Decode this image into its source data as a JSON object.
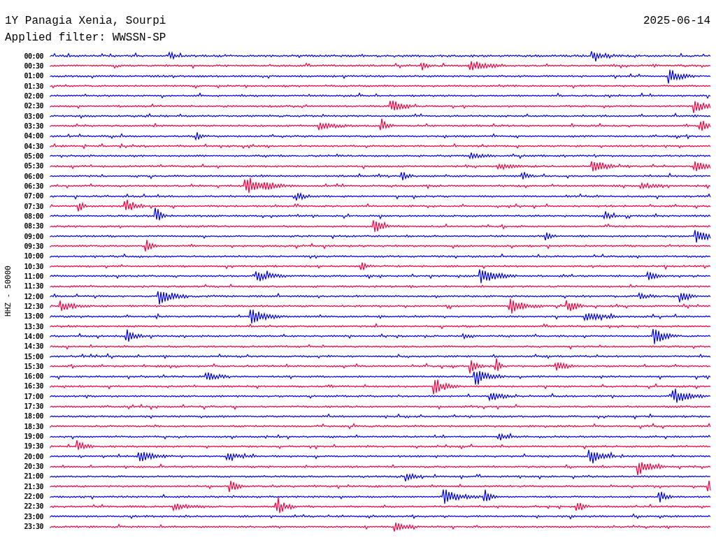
{
  "header": {
    "station": "1Y Panagia Xenia, Sourpi",
    "date": "2025-06-14",
    "filter": "Applied filter: WWSSN-SP"
  },
  "axis_label": "HHZ - 50000",
  "rows": [
    {
      "label": "00:00",
      "color": "#0000ff"
    },
    {
      "label": "00:30",
      "color": "#ff0040"
    },
    {
      "label": "01:00",
      "color": "#0000ff"
    },
    {
      "label": "01:30",
      "color": "#ff0040"
    },
    {
      "label": "02:00",
      "color": "#0000ff"
    },
    {
      "label": "02:30",
      "color": "#ff0040"
    },
    {
      "label": "03:00",
      "color": "#0000ff"
    },
    {
      "label": "03:30",
      "color": "#ff0040"
    },
    {
      "label": "04:00",
      "color": "#0000ff"
    },
    {
      "label": "04:30",
      "color": "#ff0040"
    },
    {
      "label": "05:00",
      "color": "#0000ff"
    },
    {
      "label": "05:30",
      "color": "#ff0040"
    },
    {
      "label": "06:00",
      "color": "#0000ff"
    },
    {
      "label": "06:30",
      "color": "#ff0040"
    },
    {
      "label": "07:00",
      "color": "#0000ff"
    },
    {
      "label": "07:30",
      "color": "#ff0040"
    },
    {
      "label": "08:00",
      "color": "#0000ff"
    },
    {
      "label": "08:30",
      "color": "#ff0040"
    },
    {
      "label": "09:00",
      "color": "#0000ff"
    },
    {
      "label": "09:30",
      "color": "#ff0040"
    },
    {
      "label": "10:00",
      "color": "#0000ff"
    },
    {
      "label": "10:30",
      "color": "#ff0040"
    },
    {
      "label": "11:00",
      "color": "#0000ff"
    },
    {
      "label": "11:30",
      "color": "#ff0040"
    },
    {
      "label": "12:00",
      "color": "#0000ff"
    },
    {
      "label": "12:30",
      "color": "#ff0040"
    },
    {
      "label": "13:00",
      "color": "#0000ff"
    },
    {
      "label": "13:30",
      "color": "#ff0040"
    },
    {
      "label": "14:00",
      "color": "#0000ff"
    },
    {
      "label": "14:30",
      "color": "#ff0040"
    },
    {
      "label": "15:00",
      "color": "#0000ff"
    },
    {
      "label": "15:30",
      "color": "#ff0040"
    },
    {
      "label": "16:00",
      "color": "#0000ff"
    },
    {
      "label": "16:30",
      "color": "#ff0040"
    },
    {
      "label": "17:00",
      "color": "#0000ff"
    },
    {
      "label": "17:30",
      "color": "#ff0040"
    },
    {
      "label": "18:00",
      "color": "#0000ff"
    },
    {
      "label": "18:30",
      "color": "#ff0040"
    },
    {
      "label": "19:00",
      "color": "#0000ff"
    },
    {
      "label": "19:30",
      "color": "#ff0040"
    },
    {
      "label": "20:00",
      "color": "#0000ff"
    },
    {
      "label": "20:30",
      "color": "#ff0040"
    },
    {
      "label": "21:00",
      "color": "#0000ff"
    },
    {
      "label": "21:30",
      "color": "#ff0040"
    },
    {
      "label": "22:00",
      "color": "#0000ff"
    },
    {
      "label": "22:30",
      "color": "#ff0040"
    },
    {
      "label": "23:00",
      "color": "#0000ff"
    },
    {
      "label": "23:30",
      "color": "#ff0040"
    }
  ]
}
